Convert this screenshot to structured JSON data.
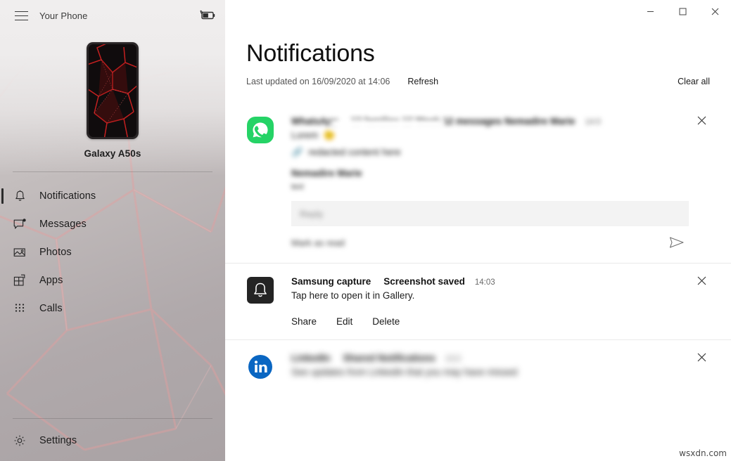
{
  "window": {
    "app_title": "Your Phone",
    "controls": {
      "minimize": "minimize-button",
      "maximize": "maximize-button",
      "close": "close-button"
    }
  },
  "sidebar": {
    "menu_icon": "hamburger-menu-icon",
    "battery_icon": "battery-charging-icon",
    "device_name": "Galaxy A50s",
    "items": [
      {
        "label": "Notifications",
        "icon": "bell-icon",
        "active": true
      },
      {
        "label": "Messages",
        "icon": "message-bubble-icon",
        "active": false
      },
      {
        "label": "Photos",
        "icon": "photo-icon",
        "active": false
      },
      {
        "label": "Apps",
        "icon": "apps-icon",
        "active": false
      },
      {
        "label": "Calls",
        "icon": "dialpad-icon",
        "active": false
      }
    ],
    "settings": {
      "label": "Settings",
      "icon": "gear-icon"
    }
  },
  "main": {
    "title": "Notifications",
    "last_updated": "Last updated on 16/09/2020 at 14:06",
    "refresh_label": "Refresh",
    "clear_all_label": "Clear all"
  },
  "notifications": [
    {
      "id": "whatsapp",
      "icon": "whatsapp-icon",
      "app": "WhatsApp",
      "title": "",
      "time": "",
      "body": "",
      "redacted": true,
      "reply": {
        "placeholder": "Reply",
        "mark_read_label": "Mark as read",
        "send_icon": "send-icon"
      },
      "dismiss_icon": "close-icon"
    },
    {
      "id": "samsung-capture",
      "icon": "bell-square-icon",
      "app": "Samsung capture",
      "title": "Screenshot saved",
      "time": "14:03",
      "body": "Tap here to open it in Gallery.",
      "redacted": false,
      "actions": [
        "Share",
        "Edit",
        "Delete"
      ],
      "dismiss_icon": "close-icon"
    },
    {
      "id": "linkedin",
      "icon": "linkedin-icon",
      "app": "LinkedIn",
      "title": "",
      "time": "",
      "body": "",
      "redacted": true,
      "dismiss_icon": "close-icon"
    }
  ],
  "watermark": "wsxdn.com",
  "colors": {
    "whatsapp_green": "#25D366",
    "linkedin_blue": "#0A66C2",
    "samsung_dark": "#242424",
    "accent_selection": "#2b2b2b",
    "wallpaper_red": "#c62828"
  }
}
